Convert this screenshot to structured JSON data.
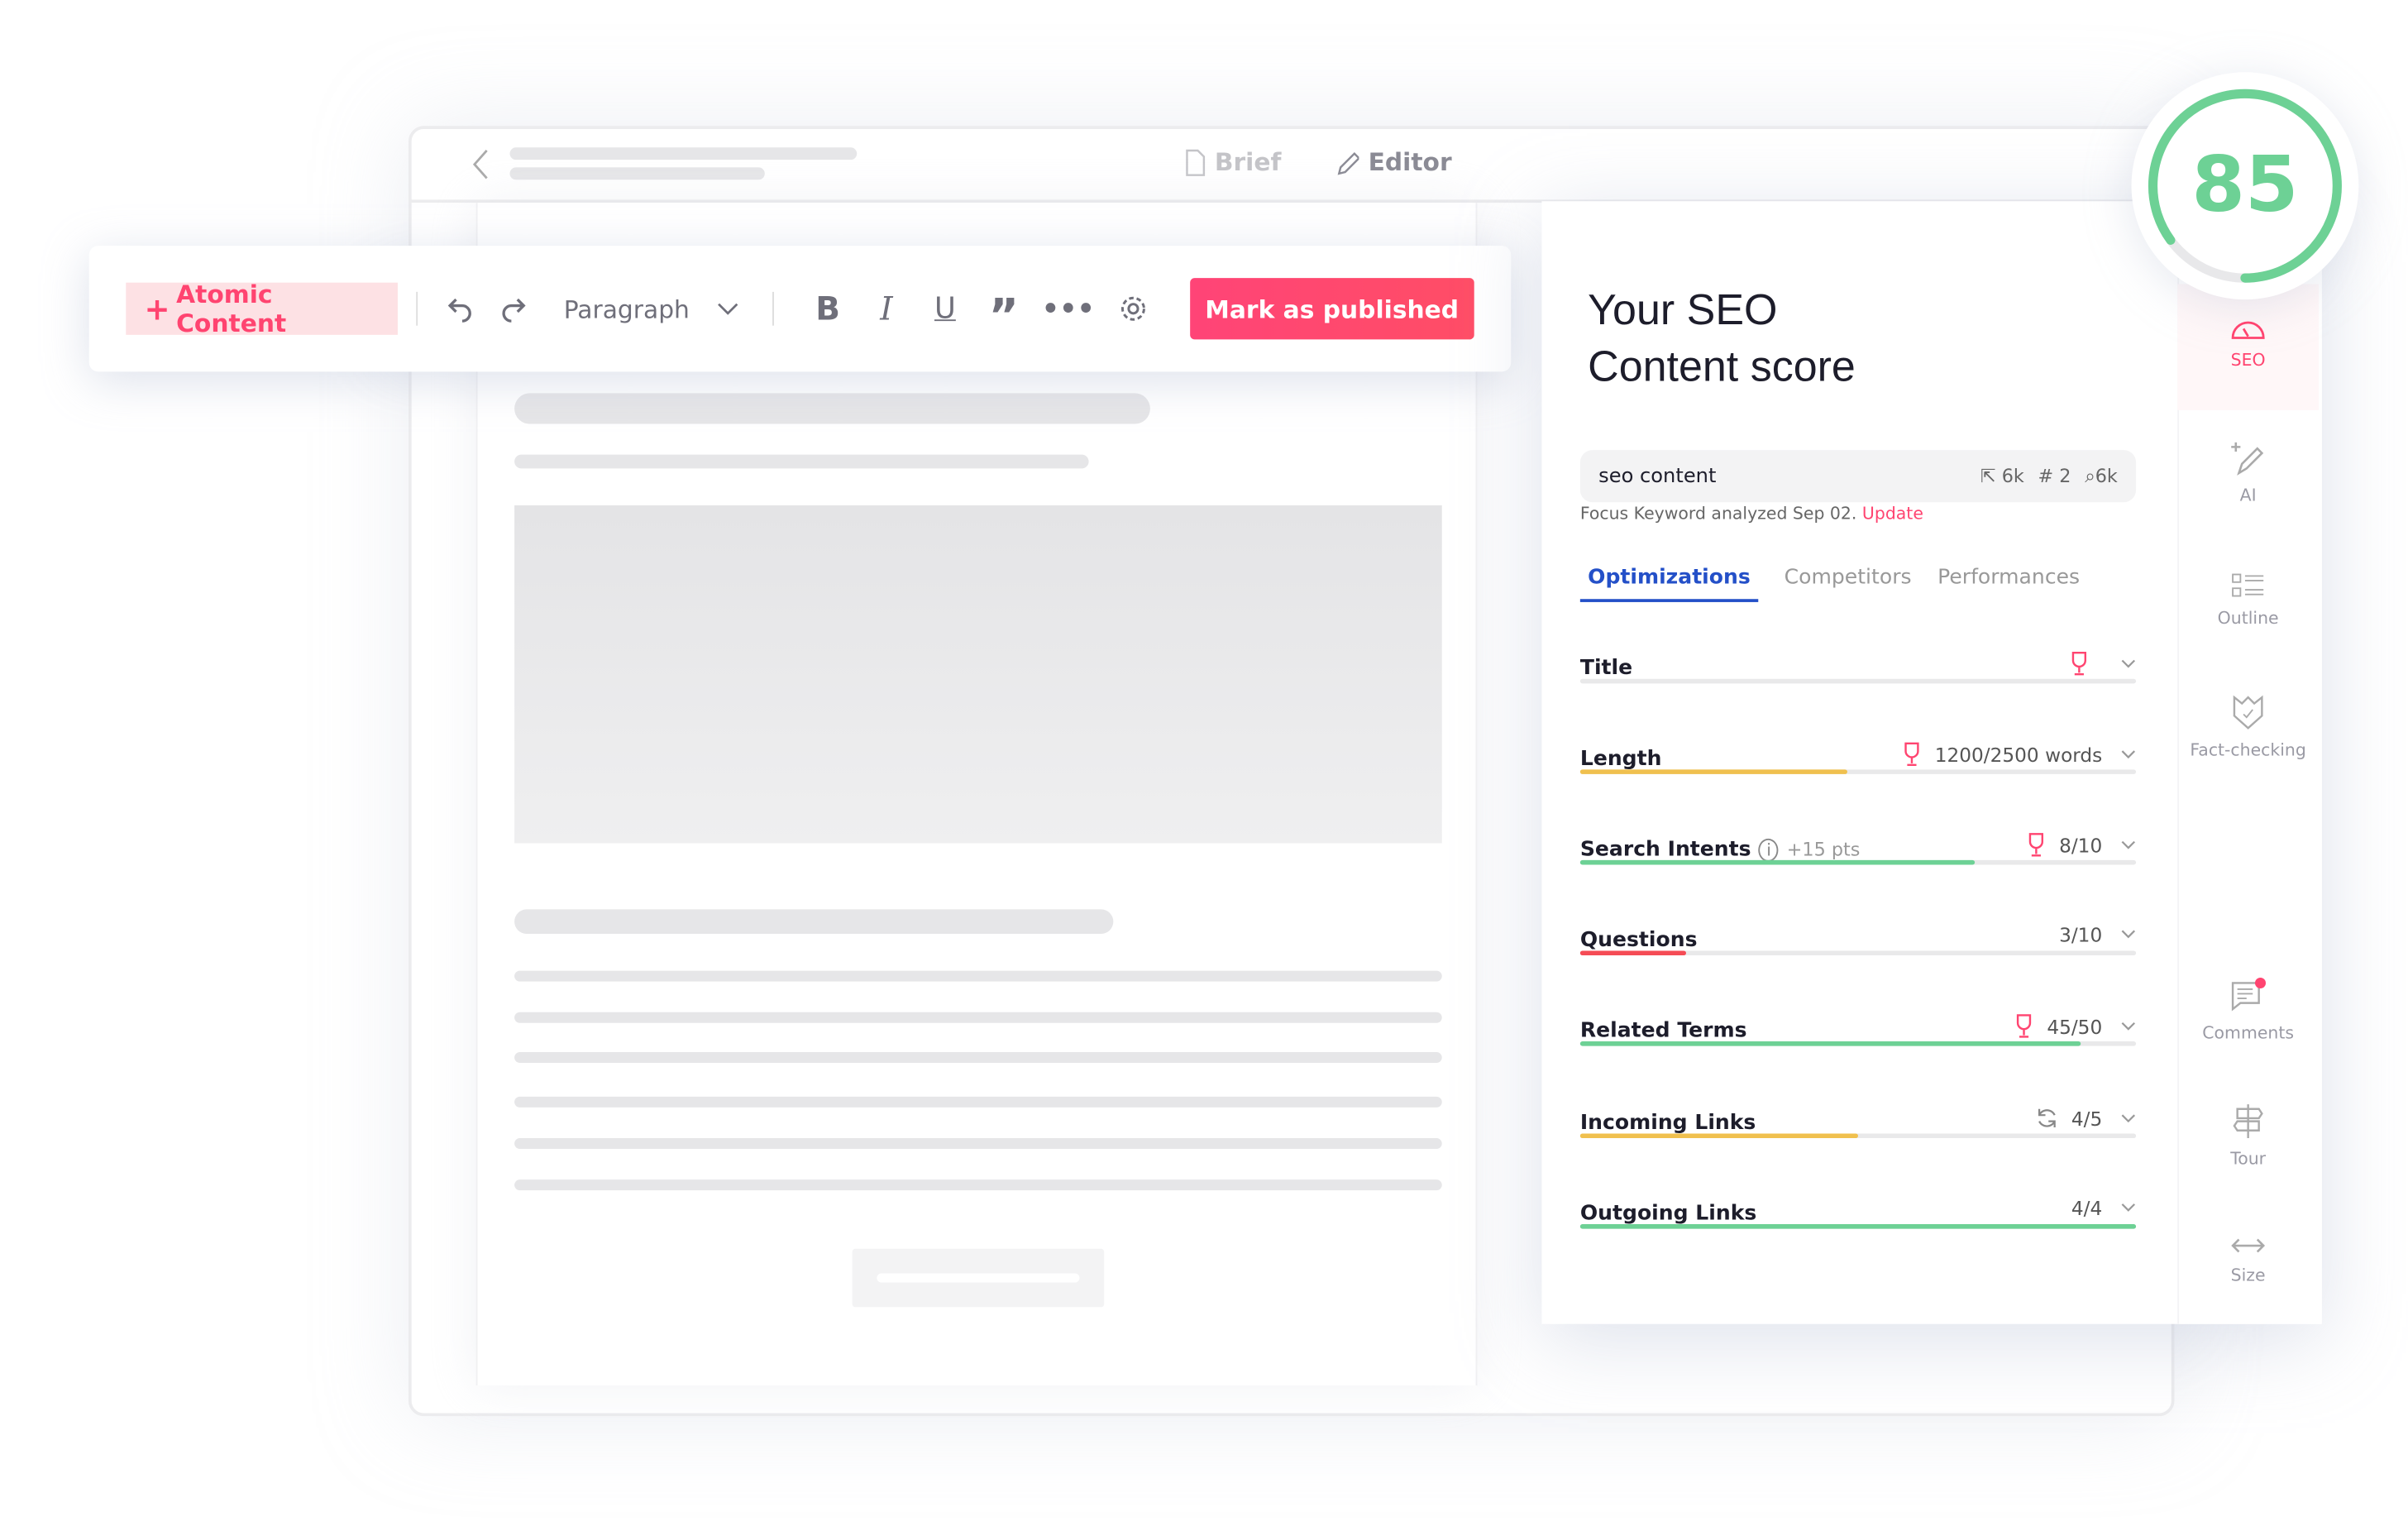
{
  "editor": {
    "tabs": [
      {
        "label": "Brief",
        "icon": "file-icon"
      },
      {
        "label": "Editor",
        "icon": "pencil-icon"
      }
    ]
  },
  "toolbar": {
    "atomic_label": "Atomic Content",
    "block_type": "Paragraph",
    "publish_label": "Mark as published",
    "accent": "#ff4470"
  },
  "seo": {
    "score": "85",
    "score_percent": 85,
    "score_color": "#6dd195",
    "heading_line1": "Your SEO",
    "heading_line2": "Content score",
    "keyword": "seo content",
    "stats": {
      "clicks": "6k",
      "rank": "# 2",
      "volume": "6k"
    },
    "analyzed_text": "Focus Keyword analyzed Sep 02.",
    "update_label": "Update",
    "tabs": [
      "Optimizations",
      "Competitors",
      "Performances"
    ],
    "active_tab": "Optimizations",
    "rows": [
      {
        "title": "Title",
        "value": "",
        "icon": "trophy-icon",
        "progress": 0,
        "color": "#e9e9ea"
      },
      {
        "title": "Length",
        "value": "1200/2500 words",
        "icon": "trophy-icon",
        "progress": 48,
        "color": "#f0c04e"
      },
      {
        "title": "Search Intents",
        "extra": "+15 pts",
        "value": "8/10",
        "icon": "trophy-icon",
        "progress": 71,
        "color": "#6dd195"
      },
      {
        "title": "Questions",
        "value": "3/10",
        "icon": "",
        "progress": 19,
        "color": "#f54b55"
      },
      {
        "title": "Related Terms",
        "value": "45/50",
        "icon": "trophy-icon",
        "progress": 90,
        "color": "#6dd195"
      },
      {
        "title": "Incoming Links",
        "value": "4/5",
        "icon": "refresh-icon",
        "progress": 50,
        "color": "#f0c04e"
      },
      {
        "title": "Outgoing Links",
        "value": "4/4",
        "icon": "",
        "progress": 100,
        "color": "#6dd195"
      }
    ]
  },
  "rail": [
    "SEO",
    "AI",
    "Outline",
    "Fact-checking",
    "Comments",
    "Tour",
    "Size"
  ]
}
